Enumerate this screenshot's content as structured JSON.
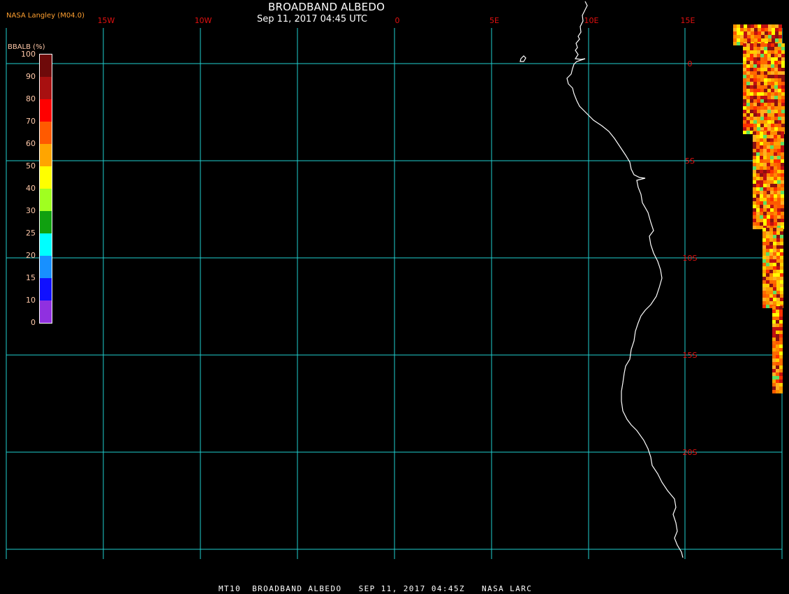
{
  "header": {
    "title": "BROADBAND ALBEDO",
    "subtitle": "Sep 11, 2017 04:45 UTC",
    "credit": "NASA Langley (M04.0)"
  },
  "footer": {
    "text": "MT10  BROADBAND ALBEDO   SEP 11, 2017 04:45Z   NASA LARC"
  },
  "colorbar": {
    "title": "BBALB (%)",
    "ticks": [
      "100",
      "90",
      "80",
      "70",
      "60",
      "50",
      "40",
      "30",
      "25",
      "20",
      "15",
      "10",
      "0"
    ],
    "colors": [
      "#6e0a0a",
      "#a81010",
      "#ff0000",
      "#ff5a00",
      "#ffa500",
      "#ffff00",
      "#a0ff20",
      "#10a010",
      "#10a010",
      "#00ffff",
      "#1890ff",
      "#1010ff",
      "#9030e0"
    ]
  },
  "grid": {
    "longitudes": [
      "15W",
      "10W",
      "0",
      "5E",
      "10E",
      "15E"
    ],
    "latitudes": [
      "0",
      "5S",
      "10S",
      "15S",
      "20S"
    ],
    "line_color": "#20d0d0",
    "label_color": "#e21010"
  },
  "coastline_color": "#ffffff"
}
